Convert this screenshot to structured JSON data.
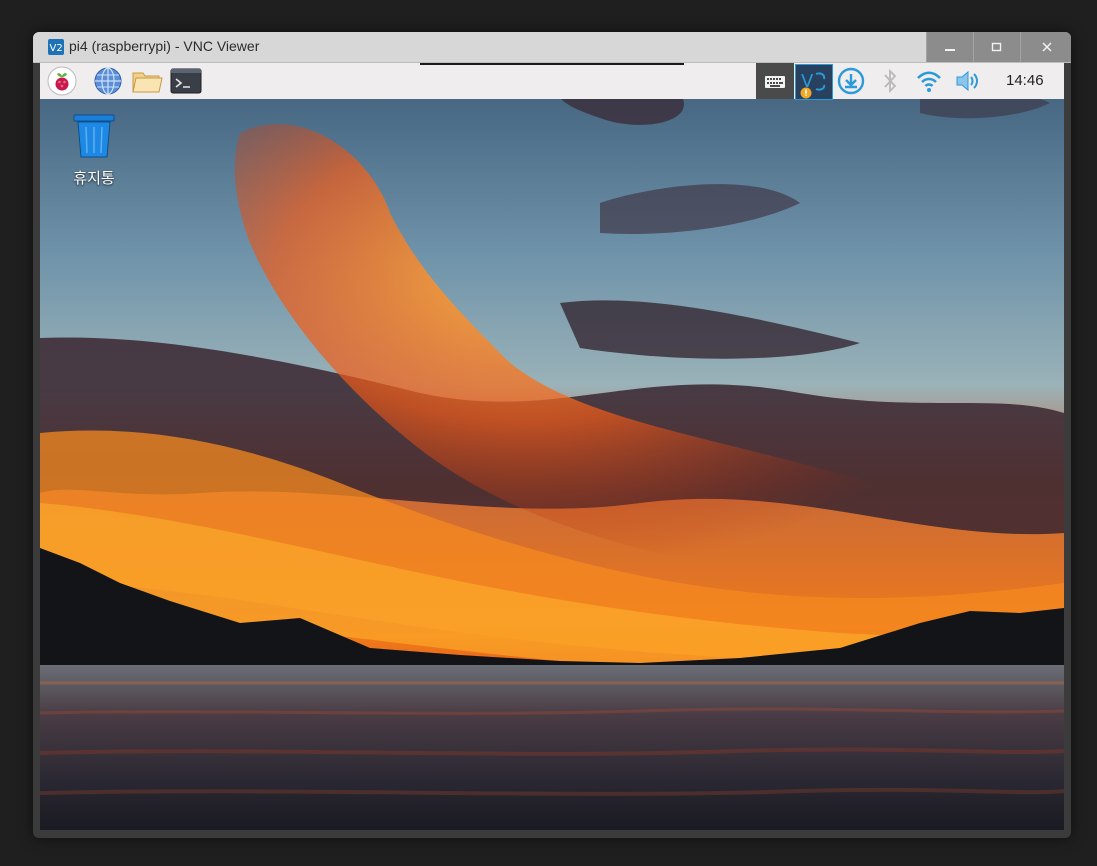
{
  "window": {
    "title": "pi4 (raspberrypi) - VNC Viewer",
    "app_logo_text": "V2"
  },
  "taskbar": {
    "clock": "14:46"
  },
  "desktop": {
    "trash_label": "휴지통"
  },
  "colors": {
    "taskbar_bg": "#efedee",
    "vnc_accent": "#1d72b8",
    "tray_blue": "#2b9ad9"
  },
  "icons": [
    "raspberry-menu-icon",
    "browser-globe-icon",
    "file-manager-icon",
    "terminal-icon",
    "keyboard-icon",
    "vnc-server-icon",
    "download-icon",
    "bluetooth-icon",
    "wifi-icon",
    "volume-icon",
    "trash-icon"
  ]
}
